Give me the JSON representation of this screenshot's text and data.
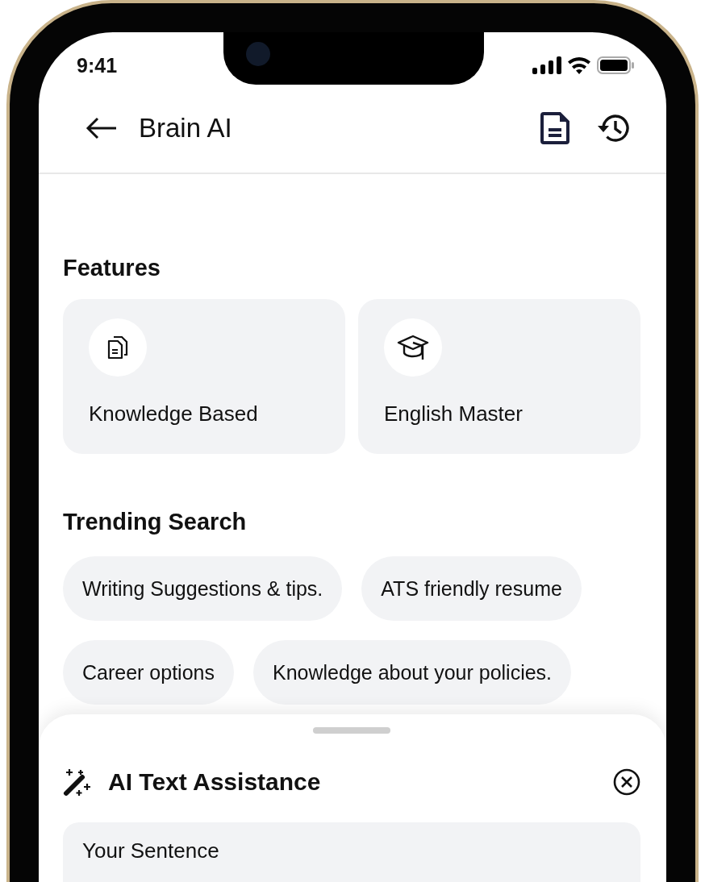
{
  "status_bar": {
    "time": "9:41"
  },
  "header": {
    "title": "Brain AI"
  },
  "features": {
    "title": "Features",
    "cards": [
      {
        "label": "Knowledge Based",
        "kind": "documents"
      },
      {
        "label": "English Master",
        "kind": "graduation"
      }
    ]
  },
  "trending": {
    "title": "Trending Search",
    "chips": [
      "Writing Suggestions & tips.",
      "ATS friendly resume",
      "Career options",
      "Knowledge about your policies."
    ]
  },
  "sheet": {
    "title": "AI Text Assistance",
    "input": {
      "placeholder": "Your Sentence"
    }
  }
}
